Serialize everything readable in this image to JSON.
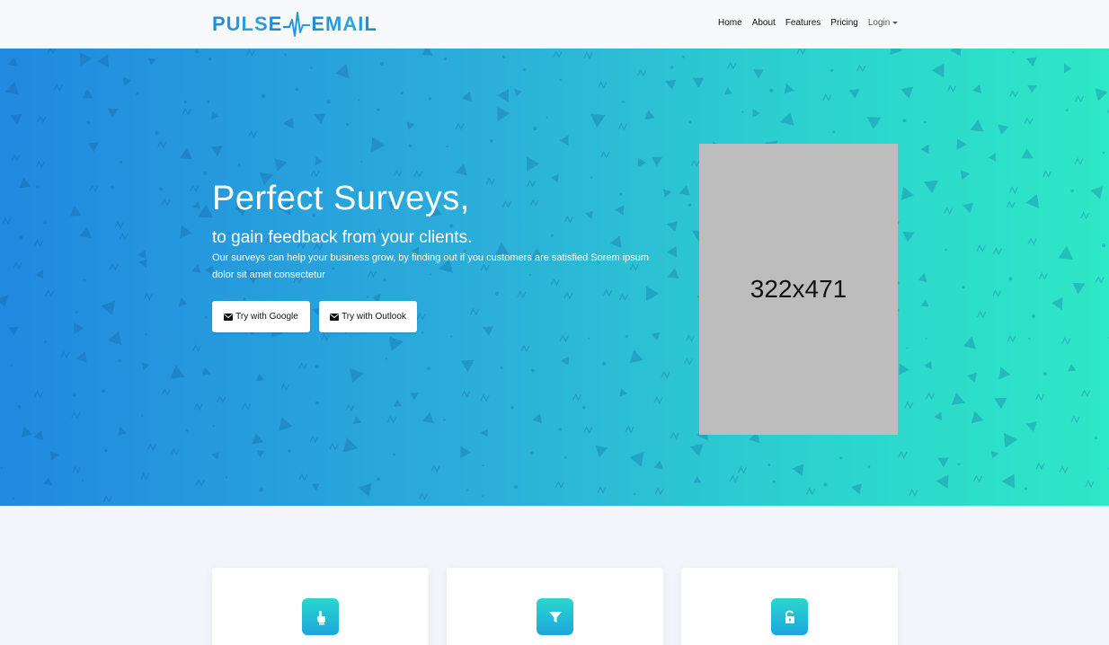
{
  "brand": {
    "logo_left": "PULSE",
    "logo_right": "EMAIL"
  },
  "nav": {
    "items": [
      {
        "label": "Home"
      },
      {
        "label": "About"
      },
      {
        "label": "Features"
      },
      {
        "label": "Pricing"
      }
    ],
    "login_label": "Login"
  },
  "hero": {
    "title": "Perfect Surveys,",
    "subtitle": "to gain feedback from your clients.",
    "description": "Our surveys can help your business grow, by finding out if you customers are satisfied Sorem ipsum dolor sit amet consectetur",
    "google_button": "Try with Google",
    "outlook_button": "Try with Outlook",
    "image_placeholder": "322x471"
  },
  "features": {
    "cards": [
      {
        "icon": "pointer-hand-icon"
      },
      {
        "icon": "filter-icon"
      },
      {
        "icon": "unlock-icon"
      }
    ]
  },
  "colors": {
    "hero_gradient_start": "#2189e0",
    "hero_gradient_end": "#2ee8c6",
    "page_background": "#f3f5fa",
    "placeholder_gray": "#bdbdbd"
  }
}
